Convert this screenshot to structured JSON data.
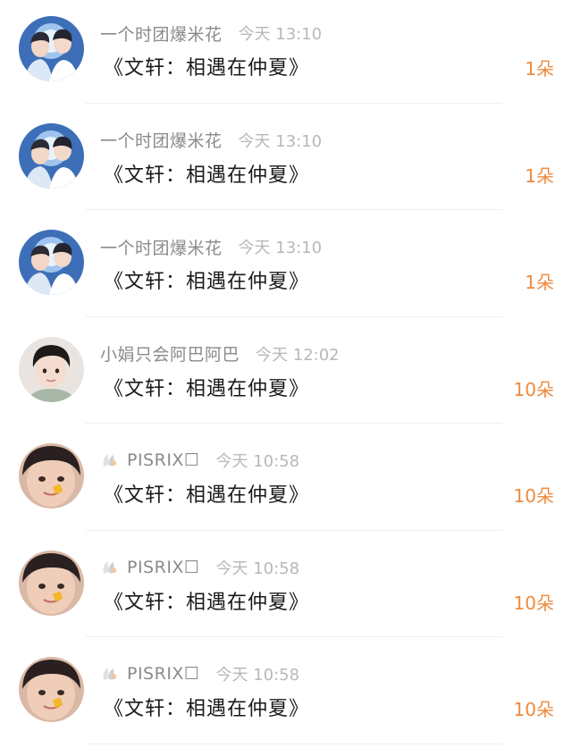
{
  "colors": {
    "name": "#8a8a8a",
    "time": "#b8b8b8",
    "text": "#1a1a1a",
    "count": "#ef8a3c",
    "divider": "#eeeeee"
  },
  "records": [
    {
      "name": "一个时团爆米花",
      "time": "今天 13:10",
      "gift": "《文轩：相遇在仲夏》",
      "count": "1朵",
      "avatar": "duo-avatar-icon",
      "badge": false
    },
    {
      "name": "一个时团爆米花",
      "time": "今天 13:10",
      "gift": "《文轩：相遇在仲夏》",
      "count": "1朵",
      "avatar": "duo-avatar-icon",
      "badge": false
    },
    {
      "name": "一个时团爆米花",
      "time": "今天 13:10",
      "gift": "《文轩：相遇在仲夏》",
      "count": "1朵",
      "avatar": "duo-avatar-icon",
      "badge": false
    },
    {
      "name": "小娟只会阿巴阿巴",
      "time": "今天 12:02",
      "gift": "《文轩：相遇在仲夏》",
      "count": "10朵",
      "avatar": "portrait-avatar-icon",
      "badge": false
    },
    {
      "name": "PISRIX☐",
      "time": "今天 10:58",
      "gift": "《文轩：相遇在仲夏》",
      "count": "10朵",
      "avatar": "face-avatar-icon",
      "badge": true
    },
    {
      "name": "PISRIX☐",
      "time": "今天 10:58",
      "gift": "《文轩：相遇在仲夏》",
      "count": "10朵",
      "avatar": "face-avatar-icon",
      "badge": true
    },
    {
      "name": "PISRIX☐",
      "time": "今天 10:58",
      "gift": "《文轩：相遇在仲夏》",
      "count": "10朵",
      "avatar": "face-avatar-icon",
      "badge": true
    }
  ]
}
